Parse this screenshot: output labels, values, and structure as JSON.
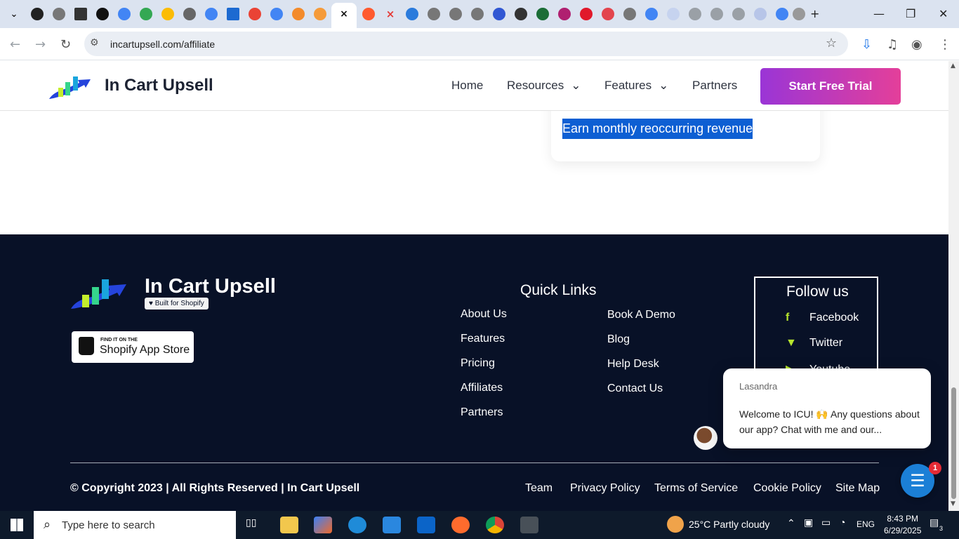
{
  "browser": {
    "url": "incartupsell.com/affiliate",
    "colors": {
      "tabbar": "#dbe3f0",
      "address": "#eaeef4"
    }
  },
  "site": {
    "brand": "In Cart Upsell",
    "nav": [
      "Home",
      "Resources",
      "Features",
      "Partners"
    ],
    "cta": "Start Free Trial",
    "card": {
      "highlighted_text": "Earn monthly reoccurring revenue"
    },
    "colors": {
      "cta_start": "#9a35d6",
      "cta_end": "#e43f9a",
      "footer": "#081127",
      "highlight": "#0d5fd3"
    }
  },
  "footer": {
    "brand": "In Cart Upsell",
    "badge": "Built for Shopify",
    "store_small": "FIND IT ON THE",
    "store_large": "Shopify App Store",
    "quick_links_title": "Quick Links",
    "links_col1": [
      "About Us",
      "Features",
      "Pricing",
      "Affiliates",
      "Partners"
    ],
    "links_col2": [
      "Book A Demo",
      "Blog",
      "Help Desk",
      "Contact Us"
    ],
    "follow_title": "Follow us",
    "social": [
      {
        "icon": "facebook-icon",
        "label": "Facebook"
      },
      {
        "icon": "twitter-icon",
        "label": "Twitter"
      },
      {
        "icon": "youtube-icon",
        "label": "Youtube"
      }
    ],
    "copyright": "© Copyright 2023 | All Rights Reserved | In Cart Upsell",
    "bottom_links": [
      "Team",
      "Privacy Policy",
      "Terms of Service",
      "Cookie Policy",
      "Site Map"
    ]
  },
  "chat": {
    "agent": "Lasandra",
    "message": "Welcome to ICU! 🙌 Any questions about our app? Chat with me and our...",
    "badge": "1"
  },
  "taskbar": {
    "search": "Type here to search",
    "weather": "25°C  Partly cloudy",
    "language": "ENG",
    "time": "8:43 PM",
    "date": "6/29/2025",
    "notifications": "3"
  }
}
